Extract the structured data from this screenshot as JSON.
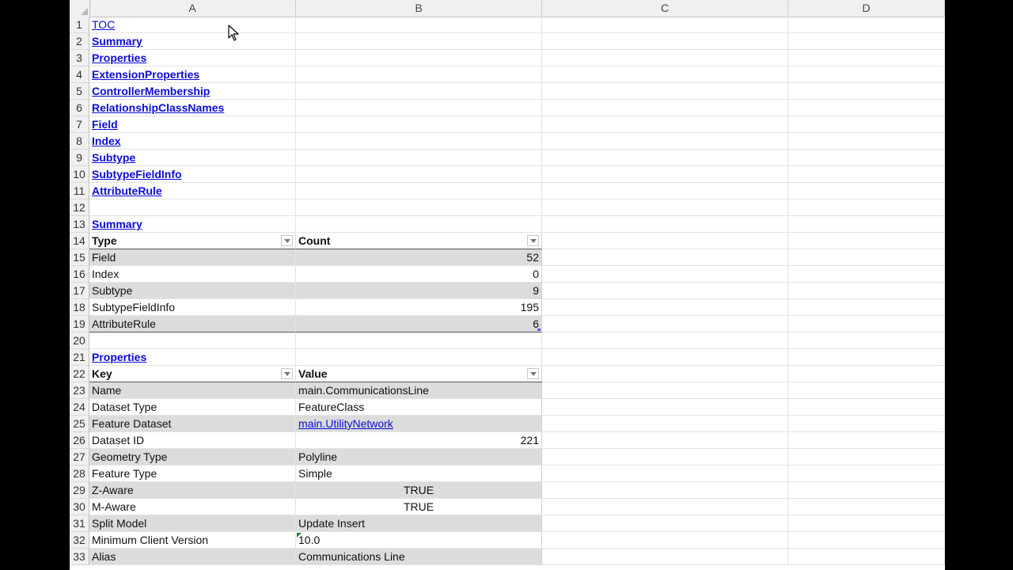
{
  "columns": [
    "A",
    "B",
    "C",
    "D"
  ],
  "rows": [
    {
      "num": "1",
      "a": "TOC",
      "a_style": "link"
    },
    {
      "num": "2",
      "a": "Summary",
      "a_style": "link-bold"
    },
    {
      "num": "3",
      "a": "Properties",
      "a_style": "link-bold"
    },
    {
      "num": "4",
      "a": "ExtensionProperties",
      "a_style": "link-bold"
    },
    {
      "num": "5",
      "a": "ControllerMembership",
      "a_style": "link-bold"
    },
    {
      "num": "6",
      "a": "RelationshipClassNames",
      "a_style": "link-bold"
    },
    {
      "num": "7",
      "a": "Field",
      "a_style": "link-bold"
    },
    {
      "num": "8",
      "a": "Index",
      "a_style": "link-bold"
    },
    {
      "num": "9",
      "a": "Subtype",
      "a_style": "link-bold"
    },
    {
      "num": "10",
      "a": "SubtypeFieldInfo",
      "a_style": "link-bold"
    },
    {
      "num": "11",
      "a": "AttributeRule",
      "a_style": "link-bold"
    },
    {
      "num": "12",
      "a": ""
    },
    {
      "num": "13",
      "a": "Summary",
      "a_style": "link-bold"
    },
    {
      "num": "14",
      "a": "Type",
      "b": "Count",
      "header": true
    },
    {
      "num": "15",
      "a": "Field",
      "b": "52",
      "b_align": "right",
      "band": true
    },
    {
      "num": "16",
      "a": "Index",
      "b": "0",
      "b_align": "right"
    },
    {
      "num": "17",
      "a": "Subtype",
      "b": "9",
      "b_align": "right",
      "band": true
    },
    {
      "num": "18",
      "a": "SubtypeFieldInfo",
      "b": "195",
      "b_align": "right"
    },
    {
      "num": "19",
      "a": "AttributeRule",
      "b": "6",
      "b_align": "right",
      "band": true,
      "table_end": true,
      "resize_mark": true
    },
    {
      "num": "20",
      "a": ""
    },
    {
      "num": "21",
      "a": "Properties",
      "a_style": "link-bold"
    },
    {
      "num": "22",
      "a": "Key",
      "b": "Value",
      "header": true
    },
    {
      "num": "23",
      "a": "Name",
      "b": "main.CommunicationsLine",
      "band": true
    },
    {
      "num": "24",
      "a": "Dataset Type",
      "b": "FeatureClass"
    },
    {
      "num": "25",
      "a": "Feature Dataset",
      "b": "main.UtilityNetwork",
      "b_style": "link",
      "band": true
    },
    {
      "num": "26",
      "a": "Dataset ID",
      "b": "221",
      "b_align": "right"
    },
    {
      "num": "27",
      "a": "Geometry Type",
      "b": "Polyline",
      "band": true
    },
    {
      "num": "28",
      "a": "Feature Type",
      "b": "Simple"
    },
    {
      "num": "29",
      "a": "Z-Aware",
      "b": "TRUE",
      "b_align": "center",
      "band": true
    },
    {
      "num": "30",
      "a": "M-Aware",
      "b": "TRUE",
      "b_align": "center"
    },
    {
      "num": "31",
      "a": "Split Model",
      "b": "Update Insert",
      "band": true
    },
    {
      "num": "32",
      "a": "Minimum Client Version",
      "b": "10.0",
      "green_mark": true
    },
    {
      "num": "33",
      "a": "Alias",
      "b": "Communications Line",
      "band": true
    }
  ]
}
